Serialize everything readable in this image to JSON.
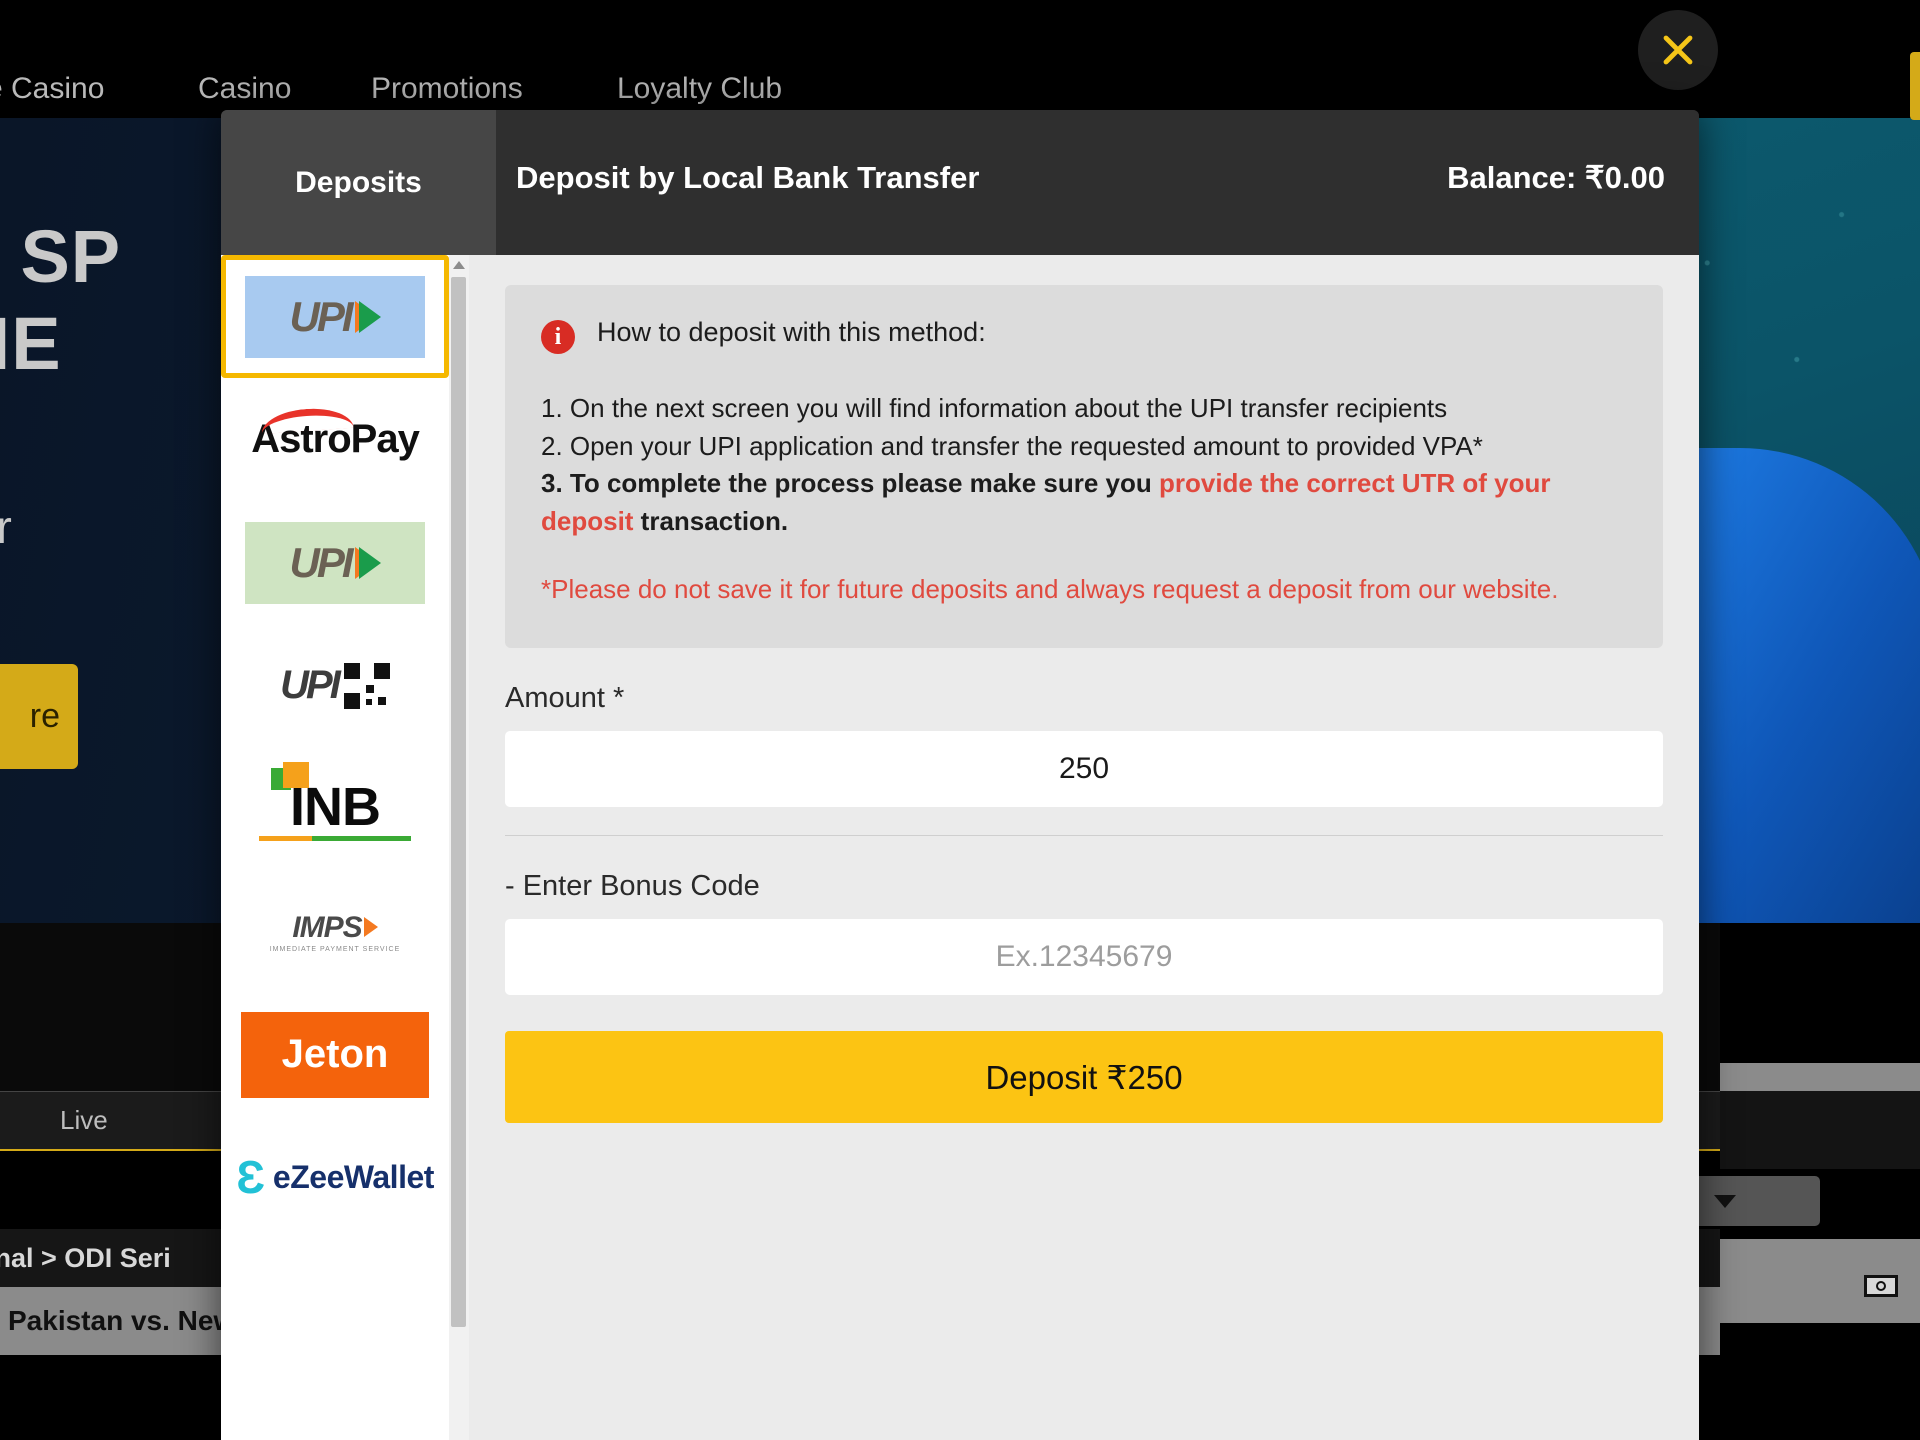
{
  "background": {
    "nav_items": [
      "e Casino",
      "Casino",
      "Promotions",
      "Loyalty Club"
    ],
    "banner_title": "KH SP\nOME",
    "banner_subtitle": "n your\nsits!",
    "banner_button": "re",
    "live_tab": "Live",
    "breadcrumb": "onal  >  ODI Seri",
    "match_row": "Pakistan vs. New ."
  },
  "close_button": {
    "name": "close",
    "color": "#f5c518"
  },
  "modal": {
    "tab_label": "Deposits",
    "title": "Deposit by Local Bank Transfer",
    "balance": "Balance: ₹0.00",
    "methods": [
      {
        "id": "upi-blue",
        "label": "UPI",
        "selected": true
      },
      {
        "id": "astropay",
        "label": "AstroPay",
        "selected": false
      },
      {
        "id": "upi-green",
        "label": "UPI",
        "selected": false
      },
      {
        "id": "upi-qr",
        "label": "UPI QR",
        "selected": false
      },
      {
        "id": "inb",
        "label": "INB",
        "selected": false
      },
      {
        "id": "imps",
        "label": "IMPS",
        "selected": false
      },
      {
        "id": "jeton",
        "label": "Jeton",
        "selected": false
      },
      {
        "id": "ezeewallet",
        "label": "eZeeWallet",
        "selected": false
      }
    ],
    "method_extra": {
      "imps_tagline": "IMMEDIATE PAYMENT SERVICE",
      "ezee_mark": "Ɛ"
    },
    "info": {
      "icon": "info-icon",
      "heading": "How to deposit with this method:",
      "step1": "1. On the next screen you will find information about the UPI transfer recipients",
      "step2": "2. Open your UPI application and transfer the requested amount to provided VPA*",
      "step3_prefix": "3. To complete the process please make sure you ",
      "step3_red": "provide the correct UTR of your deposit",
      "step3_suffix": " transaction.",
      "note_red": "*Please do not save it for future deposits and always request a deposit from our website",
      "note_tail": "."
    },
    "form": {
      "amount_label": "Amount *",
      "amount_value": "250",
      "amount_placeholder": "Amount",
      "bonus_label": "- Enter Bonus Code",
      "bonus_value": "",
      "bonus_placeholder": "Ex.12345679",
      "deposit_button": "Deposit ₹250"
    }
  }
}
